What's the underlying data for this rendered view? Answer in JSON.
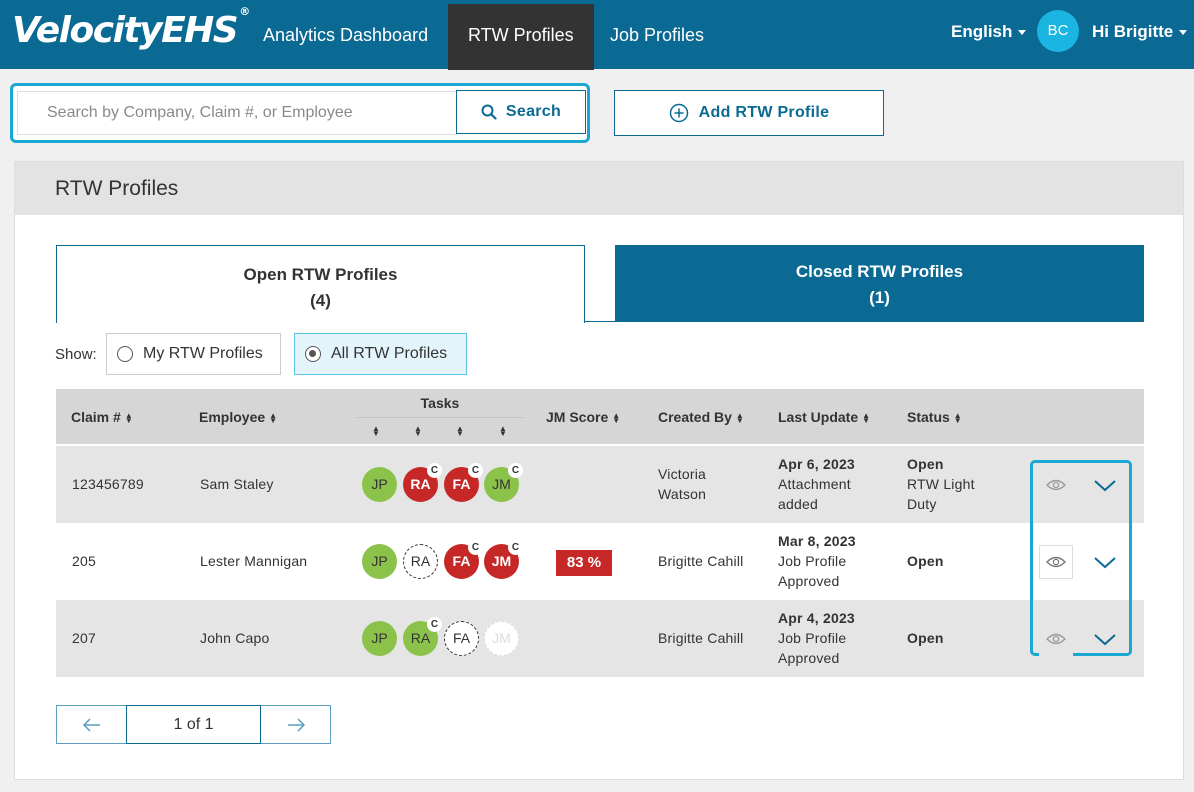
{
  "header": {
    "logo": "VelocityEHS",
    "logo_mark": "®",
    "nav": [
      "Analytics Dashboard",
      "RTW Profiles",
      "Job Profiles"
    ],
    "language": "English",
    "avatar_initials": "BC",
    "greeting": "Hi Brigitte"
  },
  "search": {
    "placeholder": "Search by Company, Claim #, or Employee",
    "button_label": "Search"
  },
  "add_button_label": "Add RTW Profile",
  "panel": {
    "title": "RTW Profiles",
    "tabs": {
      "open": {
        "label": "Open RTW Profiles",
        "count": "(4)"
      },
      "closed": {
        "label": "Closed RTW Profiles",
        "count": "(1)"
      }
    },
    "show_label": "Show:",
    "filters": [
      "My RTW Profiles",
      "All RTW Profiles"
    ],
    "selected_filter": "All RTW Profiles"
  },
  "table": {
    "columns": {
      "claim": "Claim #",
      "employee": "Employee",
      "tasks": "Tasks",
      "jm_score": "JM Score",
      "created_by": "Created By",
      "last_update": "Last Update",
      "status": "Status"
    },
    "rows": [
      {
        "claim": "123456789",
        "employee": "Sam Staley",
        "tasks": [
          {
            "label": "JP",
            "state": "green",
            "badge": ""
          },
          {
            "label": "RA",
            "state": "red",
            "badge": "C"
          },
          {
            "label": "FA",
            "state": "red",
            "badge": "C"
          },
          {
            "label": "JM",
            "state": "green",
            "badge": "C"
          }
        ],
        "jm_score": "",
        "created_by": [
          "Victoria",
          "Watson"
        ],
        "update_date": "Apr 6, 2023",
        "update_text": [
          "Attachment",
          "added"
        ],
        "status": "Open",
        "status_detail": [
          "RTW Light",
          "Duty"
        ]
      },
      {
        "claim": "205",
        "employee": "Lester Mannigan",
        "tasks": [
          {
            "label": "JP",
            "state": "green",
            "badge": ""
          },
          {
            "label": "RA",
            "state": "dashed",
            "badge": ""
          },
          {
            "label": "FA",
            "state": "red",
            "badge": "C"
          },
          {
            "label": "JM",
            "state": "red",
            "badge": "C"
          }
        ],
        "jm_score": "83 %",
        "created_by": [
          "Brigitte Cahill"
        ],
        "update_date": "Mar 8, 2023",
        "update_text": [
          "Job Profile",
          "Approved"
        ],
        "status": "Open",
        "status_detail": []
      },
      {
        "claim": "207",
        "employee": "John Capo",
        "tasks": [
          {
            "label": "JP",
            "state": "green",
            "badge": ""
          },
          {
            "label": "RA",
            "state": "green",
            "badge": "C"
          },
          {
            "label": "FA",
            "state": "dashed",
            "badge": ""
          },
          {
            "label": "JM",
            "state": "faint",
            "badge": ""
          }
        ],
        "jm_score": "",
        "created_by": [
          "Brigitte Cahill"
        ],
        "update_date": "Apr 4, 2023",
        "update_text": [
          "Job Profile",
          "Approved"
        ],
        "status": "Open",
        "status_detail": []
      }
    ]
  },
  "pagination": {
    "label": "1 of 1"
  },
  "colors": {
    "brand": "#0b6a93",
    "highlight": "#1aa8d2",
    "green": "#8bc34a",
    "red": "#c62828"
  }
}
